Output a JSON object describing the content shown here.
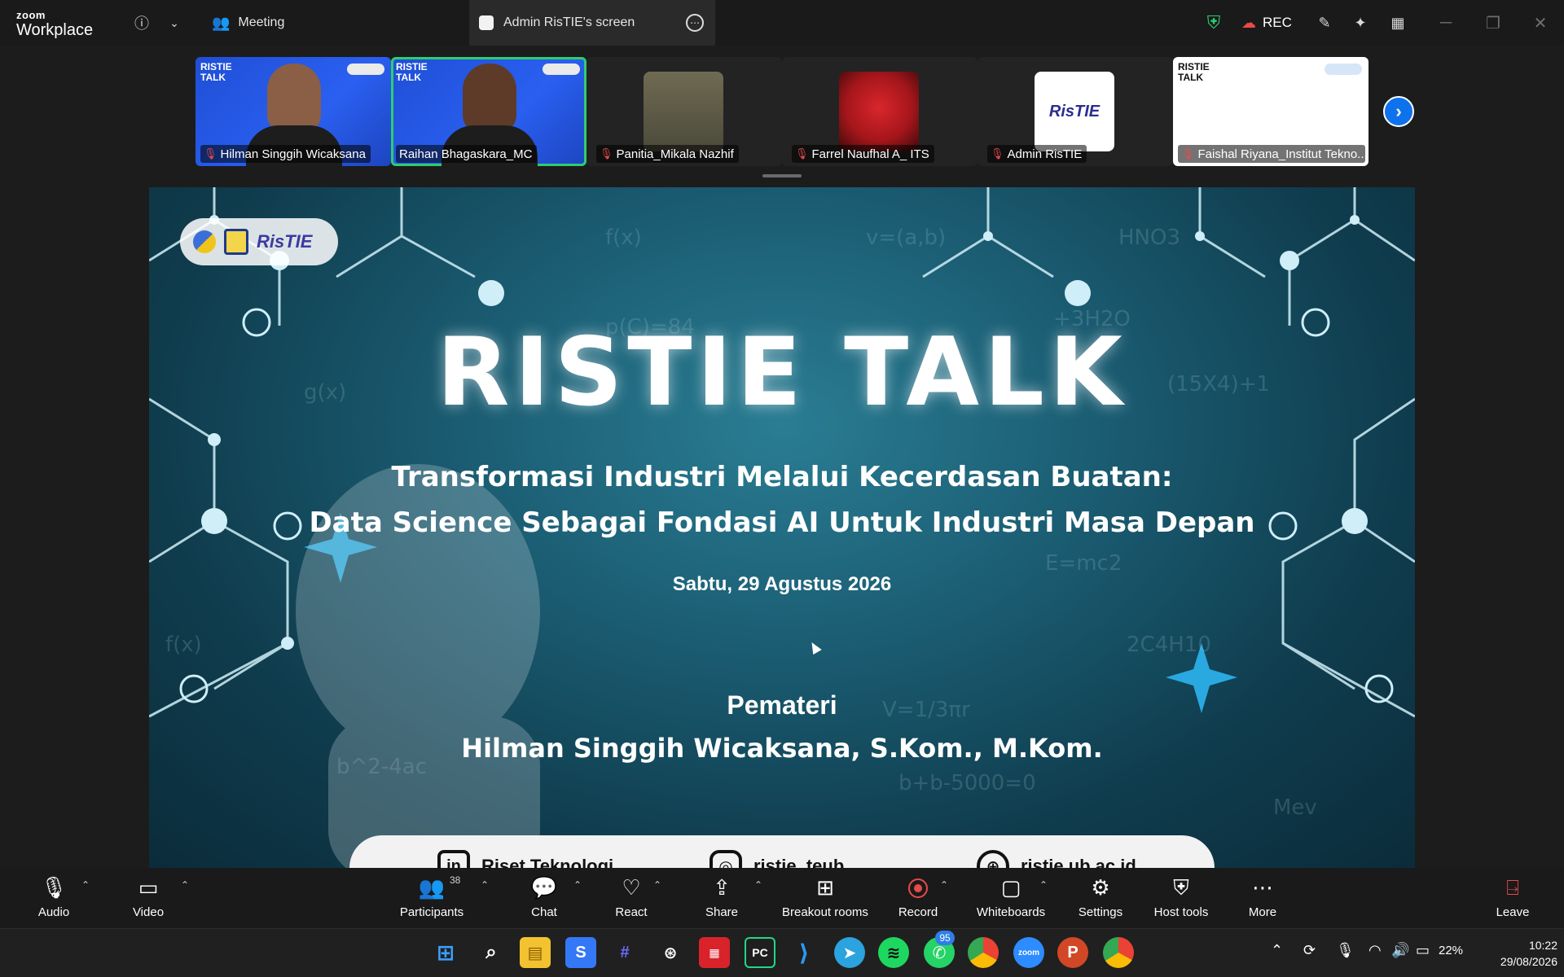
{
  "titlebar": {
    "brand_top": "zoom",
    "brand_bottom": "Workplace",
    "tab_meeting": "Meeting",
    "tab_screen": "Admin RisTIE's screen",
    "rec_label": "REC"
  },
  "participants_strip": [
    {
      "name": "Hilman Singgih Wicaksana",
      "muted": true
    },
    {
      "name": "Raihan Bhagaskara_MC",
      "muted": false
    },
    {
      "name": "Panitia_Mikala Nazhif",
      "muted": true
    },
    {
      "name": "Farrel Naufhal A_ ITS",
      "muted": true
    },
    {
      "name": "Admin RisTIE",
      "muted": true
    },
    {
      "name": "Faishal Riyana_Institut Tekno...",
      "muted": true
    }
  ],
  "thumb_logo": "RISTIE TALK",
  "admin_logo": "RisTIE",
  "slide": {
    "title": "RISTIE TALK",
    "subtitle_line1": "Transformasi Industri Melalui Kecerdasan Buatan:",
    "subtitle_line2": "Data Science Sebagai Fondasi AI Untuk Industri Masa Depan",
    "date": "Sabtu, 29 Agustus 2026",
    "speaker_heading": "Pemateri",
    "speaker_name": "Hilman Singgih Wicaksana, S.Kom., M.Kom.",
    "logo_text": "RisTIE",
    "footer": {
      "linkedin": "Riset Teknologi",
      "instagram": "ristie_teub",
      "website": "ristie.ub.ac.id"
    }
  },
  "toolbar": {
    "audio": "Audio",
    "video": "Video",
    "participants": "Participants",
    "participants_count": "38",
    "chat": "Chat",
    "react": "React",
    "share": "Share",
    "breakout": "Breakout rooms",
    "record": "Record",
    "whiteboards": "Whiteboards",
    "settings": "Settings",
    "host_tools": "Host tools",
    "more": "More",
    "leave": "Leave"
  },
  "taskbar": {
    "whatsapp_badge": "95",
    "battery": "22%",
    "time": "10:22",
    "date": "29/08/2026"
  },
  "colors": {
    "accent": "#0e72ed",
    "active_speaker": "#2ecc71",
    "muted": "#e94a4a",
    "slide_bg": "#1b5d73"
  }
}
